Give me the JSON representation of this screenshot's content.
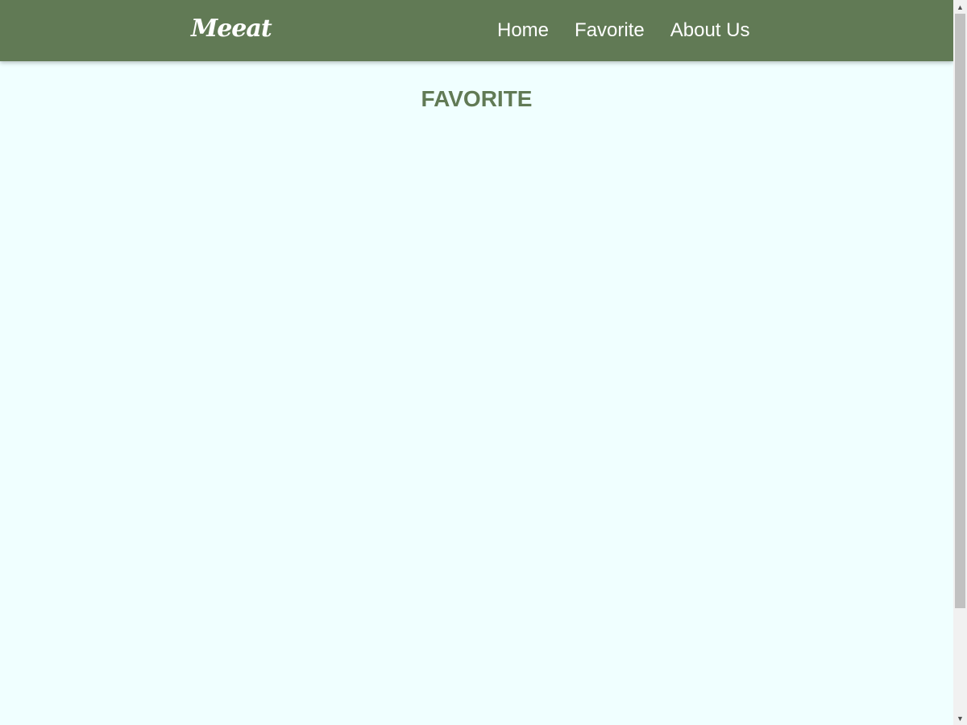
{
  "navbar": {
    "brand": "Meeat",
    "links": [
      {
        "label": "Home"
      },
      {
        "label": "Favorite"
      },
      {
        "label": "About Us"
      }
    ]
  },
  "main": {
    "title": "FAVORITE"
  },
  "colors": {
    "navbar_bg": "#617a55",
    "page_bg": "#f0ffff",
    "title_color": "#617a55",
    "nav_text": "#ffffff"
  },
  "icons": {
    "scroll_up": "scroll-up-arrow-icon",
    "scroll_down": "scroll-down-arrow-icon"
  }
}
